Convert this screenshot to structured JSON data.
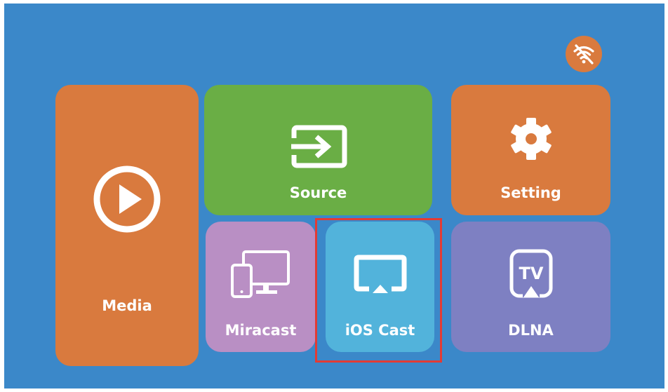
{
  "status": {
    "wifi_icon": "wifi-off-icon"
  },
  "tiles": {
    "media": {
      "label": "Media",
      "icon": "play-circle-icon",
      "color": "#D97A3E"
    },
    "source": {
      "label": "Source",
      "icon": "input-source-icon",
      "color": "#6AAE45"
    },
    "setting": {
      "label": "Setting",
      "icon": "gear-icon",
      "color": "#D97A3E"
    },
    "miracast": {
      "label": "Miracast",
      "icon": "phone-monitor-icon",
      "color": "#B98FC4"
    },
    "ios_cast": {
      "label": "iOS Cast",
      "icon": "airplay-icon",
      "color": "#52B3DB"
    },
    "dlna": {
      "label": "DLNA",
      "icon": "tv-cast-icon",
      "color": "#7E80C2"
    }
  },
  "focus": {
    "selected": "ios_cast",
    "frame_color": "#E23B35"
  },
  "background_color": "#3B88C9"
}
